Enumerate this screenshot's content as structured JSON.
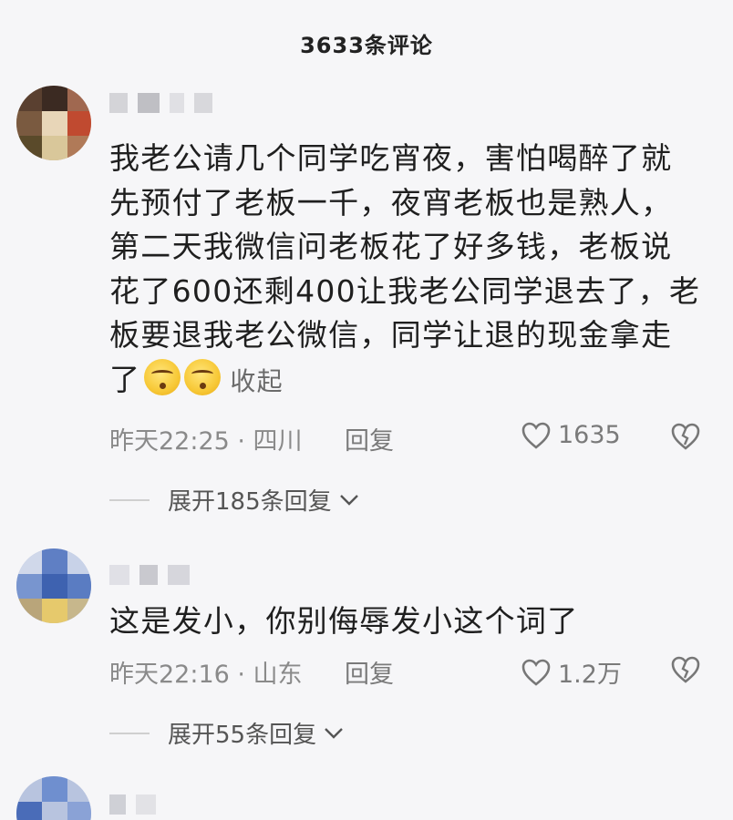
{
  "header": {
    "title": "3633条评论"
  },
  "comments": [
    {
      "text": "我老公请几个同学吃宵夜，害怕喝醉了就先预付了老板一千，夜宵老板也是熟人，第二天我微信问老板花了好多钱，老板说花了600还剩400让我老公同学退去了，老板要退我老公微信，同学让退的现金拿走了",
      "collapse_label": "收起",
      "time": "昨天22:25 · 四川",
      "reply_label": "回复",
      "likes": "1635",
      "expand_label": "展开185条回复"
    },
    {
      "text": "这是发小，你别侮辱发小这个词了",
      "time": "昨天22:16 · 山东",
      "reply_label": "回复",
      "likes": "1.2万",
      "expand_label": "展开55条回复"
    }
  ],
  "icons": {
    "like": "heart-outline-icon",
    "dislike": "broken-heart-icon",
    "expand": "chevron-down-icon",
    "emoji": "drooling-face-emoji"
  },
  "colors": {
    "background": "#f6f6f8",
    "text": "#1f1f1f",
    "meta": "#8a8a8a"
  }
}
